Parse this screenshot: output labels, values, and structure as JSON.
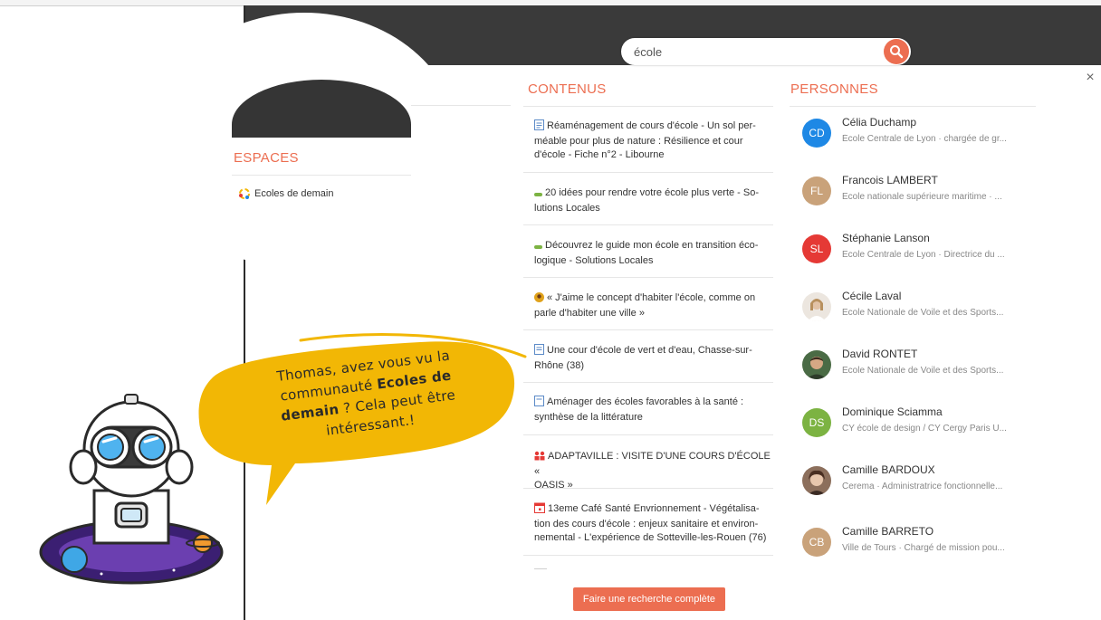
{
  "search": {
    "value": "école"
  },
  "close_label": "×",
  "sections": {
    "espaces": "ESPACES",
    "contenus": "CONTENUS",
    "personnes": "PERSONNES"
  },
  "espaces": [
    {
      "label": "Ecoles de demain",
      "icon": "community-icon"
    }
  ],
  "contenus": [
    {
      "icon": "document-icon",
      "lines": [
        "Réaménagement de cours d'école - Un sol per-",
        "méable pour plus de nature : Résilience et cour",
        "d'école - Fiche n°2 - Libourne"
      ]
    },
    {
      "icon": "link-icon",
      "lines": [
        "20 idées pour rendre votre école plus verte - So-",
        "lutions Locales"
      ]
    },
    {
      "icon": "link-icon",
      "lines": [
        "Découvrez le guide mon école en transition éco-",
        "logique - Solutions Locales"
      ]
    },
    {
      "icon": "quote-icon",
      "lines": [
        "« J'aime le concept d'habiter l'école, comme on",
        "parle d'habiter une ville »"
      ]
    },
    {
      "icon": "document-icon",
      "lines": [
        "Une cour d'école de vert et d'eau, Chasse-sur-",
        "Rhône (38)"
      ]
    },
    {
      "icon": "document-icon",
      "lines": [
        "Aménager des écoles favorables à la santé :",
        "synthèse de la littérature"
      ]
    },
    {
      "icon": "group-icon",
      "lines": [
        "ADAPTAVILLE : VISITE D'UNE COURS D'ÉCOLE «",
        "OASIS »"
      ]
    },
    {
      "icon": "calendar-icon",
      "lines": [
        "13eme Café Santé Envrionnement - Végétalisa-",
        "tion des cours d'école : enjeux sanitaire et environ-",
        "nemental - L'expérience de Sotteville-les-Rouen (76)"
      ]
    }
  ],
  "personnes": [
    {
      "initials": "CD",
      "color": "#1e88e5",
      "name": "Célia Duchamp",
      "sub": "École Centrale de Lyon · chargée de gr..."
    },
    {
      "initials": "FL",
      "color": "#c9a27a",
      "name": "Francois LAMBERT",
      "sub": "Ecole nationale supérieure maritime · ..."
    },
    {
      "initials": "SL",
      "color": "#e53935",
      "name": "Stéphanie Lanson",
      "sub": "Ecole Centrale de Lyon · Directrice du ..."
    },
    {
      "initials": "",
      "color": "#d8c2ad",
      "name": "Cécile Laval",
      "sub": "Ecole Nationale de Voile et des Sports..."
    },
    {
      "initials": "",
      "color": "#4a6b45",
      "name": "David RONTET",
      "sub": "Ecole Nationale de Voile et des Sports..."
    },
    {
      "initials": "DS",
      "color": "#7cb342",
      "name": "Dominique Sciamma",
      "sub": "CY école de design / CY Cergy Paris U..."
    },
    {
      "initials": "",
      "color": "#7a5b4a",
      "name": "Camille BARDOUX",
      "sub": "Cerema · Administratrice fonctionnelle..."
    },
    {
      "initials": "CB",
      "color": "#c9a27a",
      "name": "Camille BARRETO",
      "sub": "Ville de Tours · Chargé de mission pou..."
    }
  ],
  "full_search_label": "Faire une recherche complète",
  "bubble": {
    "line1": "Thomas, avez vous vu la",
    "line2_pre": "communauté ",
    "line2_bold": "Ecoles de",
    "line3_bold": "demain",
    "line3_post": " ? Cela peut être",
    "line4": "intéressant.!"
  },
  "colors": {
    "accent": "#ec6e51",
    "bubble": "#f2b705",
    "dark": "#3a3a3a"
  }
}
